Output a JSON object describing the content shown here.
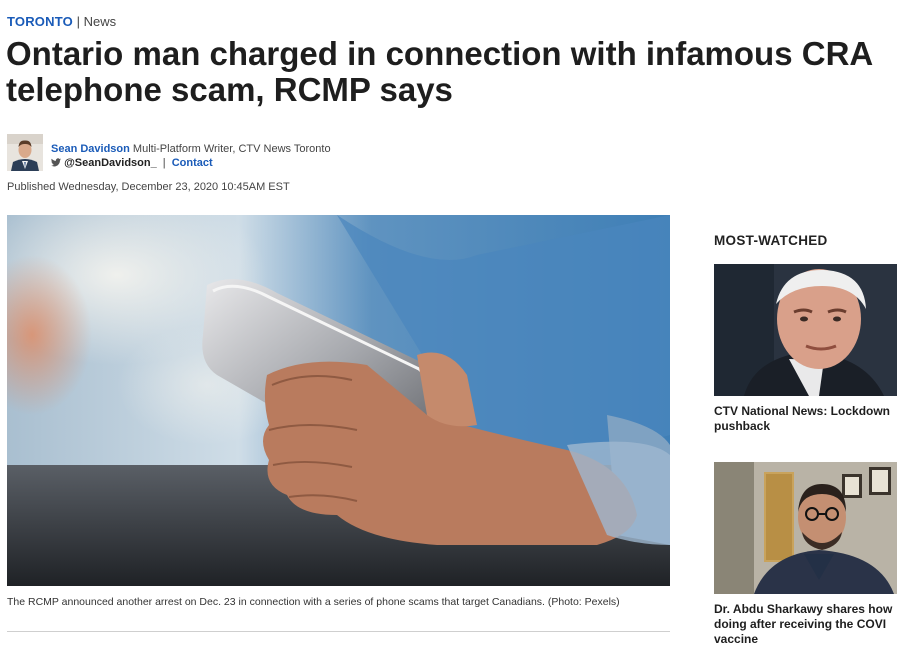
{
  "breadcrumb": {
    "section": "TORONTO",
    "separator": "|",
    "subsection": "News"
  },
  "article": {
    "title": "Ontario man charged in connection with infamous CRA telephone scam, RCMP says",
    "author": {
      "name": "Sean Davidson",
      "role": "Multi-Platform Writer, CTV News Toronto",
      "twitter": "@SeanDavidson_",
      "separator": "|",
      "contact_label": "Contact"
    },
    "published": "Published Wednesday, December 23, 2020 10:45AM EST",
    "image_caption": "The RCMP announced another arrest on Dec. 23 in connection with a series of phone scams that target Canadians. (Photo: Pexels)"
  },
  "sidebar": {
    "heading": "MOST-WATCHED",
    "videos": [
      {
        "title_line1": "CTV National News: Lockdown",
        "title_line2": "pushback"
      },
      {
        "title_line1": "Dr. Abdu Sharkawy shares how",
        "title_line2": "doing after receiving the COVI",
        "title_line3": "vaccine"
      }
    ]
  },
  "colors": {
    "link_blue": "#1a5bb8",
    "text": "#1e1e1e",
    "muted": "#444444"
  },
  "icons": {
    "twitter": "twitter-bird-icon"
  }
}
